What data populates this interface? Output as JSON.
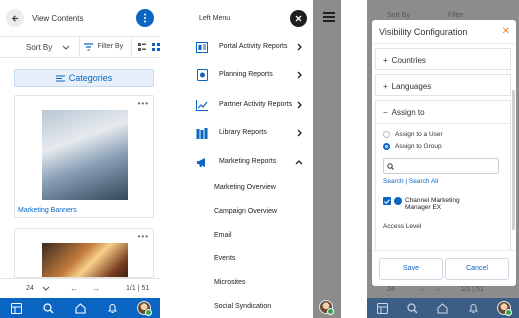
{
  "panel1": {
    "header_title": "View Contents",
    "sort_label": "Sort By",
    "filter_label": "Filter By",
    "categories_label": "Categories",
    "card1_title": "Marketing Banners",
    "page_size": "24",
    "page_count": "1/1 | 51"
  },
  "panel2": {
    "drawer_title": "Left Menu",
    "items": [
      {
        "label": "Portal Activity Reports",
        "icon": "report-icon"
      },
      {
        "label": "Planning Reports",
        "icon": "planning-icon"
      },
      {
        "label": "Partner Activity Reports",
        "icon": "chart-icon"
      },
      {
        "label": "Library Reports",
        "icon": "library-icon"
      },
      {
        "label": "Marketing Reports",
        "icon": "megaphone-icon"
      }
    ],
    "sub_items": [
      "Marketing Overview",
      "Campaign Overview",
      "Email",
      "Events",
      "Microsites",
      "Social Syndication"
    ]
  },
  "panel3": {
    "bg_sort": "Sort By",
    "bg_filter": "Filter",
    "bg_page_size": "24",
    "bg_page_count": "1/1 | 51",
    "modal_title": "Visibility Configuration",
    "countries_label": "Countries",
    "languages_label": "Languages",
    "assign_label": "Assign to",
    "assign_user": "Assign to a User",
    "assign_group": "Assign to Group",
    "search_links": "Search | Search All",
    "member_label": "Channel Marketing Manager EX",
    "access_level": "Access Level",
    "save_label": "Save",
    "cancel_label": "Cancel"
  },
  "colors": {
    "accent": "#0a66c2",
    "close_orange": "#f08a2c",
    "overlay": "#8c8c8c"
  }
}
